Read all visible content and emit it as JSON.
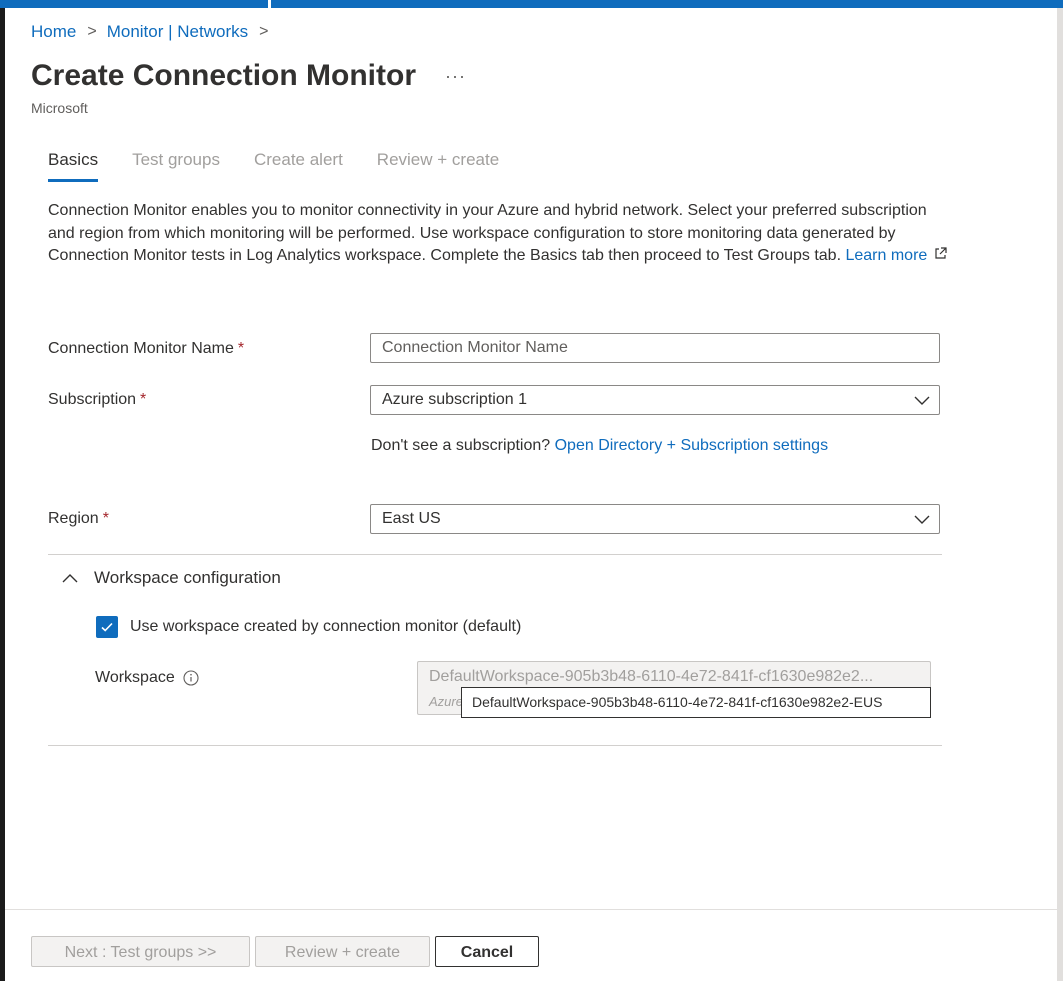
{
  "breadcrumb": {
    "items": [
      "Home",
      "Monitor | Networks"
    ],
    "separator": ">"
  },
  "page": {
    "title": "Create Connection Monitor",
    "more": "···",
    "publisher": "Microsoft"
  },
  "tabs": [
    {
      "label": "Basics",
      "active": true
    },
    {
      "label": "Test groups",
      "active": false
    },
    {
      "label": "Create alert",
      "active": false
    },
    {
      "label": "Review + create",
      "active": false
    }
  ],
  "intro": {
    "text": "Connection Monitor enables you to monitor connectivity in your Azure and hybrid network. Select your preferred subscription and region from which monitoring will be performed. Use workspace configuration to store monitoring data generated by Connection Monitor tests in Log Analytics workspace. Complete the Basics tab then proceed to Test Groups tab.",
    "link": "Learn more"
  },
  "form": {
    "name": {
      "label": "Connection Monitor Name",
      "required": "*",
      "placeholder": "Connection Monitor Name",
      "value": ""
    },
    "subscription": {
      "label": "Subscription",
      "required": "*",
      "value": "Azure subscription 1"
    },
    "subscription_help": {
      "text": "Don't see a subscription?",
      "link": "Open Directory + Subscription settings"
    },
    "region": {
      "label": "Region",
      "required": "*",
      "value": "East US"
    }
  },
  "workspace": {
    "section_title": "Workspace configuration",
    "checkbox_label": "Use workspace created by connection monitor (default)",
    "checked": true,
    "label": "Workspace",
    "value": "DefaultWorkspace-905b3b48-6110-4e72-841f-cf1630e982e2...",
    "sub": "Azure",
    "tooltip": "DefaultWorkspace-905b3b48-6110-4e72-841f-cf1630e982e2-EUS"
  },
  "footer": {
    "next": "Next : Test groups >>",
    "review": "Review + create",
    "cancel": "Cancel"
  },
  "colors": {
    "accent": "#0f6cbd",
    "required": "#a4262c",
    "disabled_text": "#a19f9d"
  }
}
